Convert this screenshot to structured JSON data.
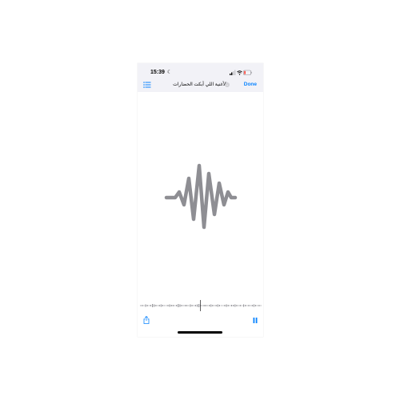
{
  "status_bar": {
    "time": "15:39",
    "moon_glyph": "☾"
  },
  "nav": {
    "title": "الأغنية اللي أبكت الحضارات",
    "done_label": "Done",
    "chevron_glyph": "⌄",
    "accent_color": "#0a84ff"
  },
  "main": {
    "icon": "audio-waveform-icon",
    "icon_color": "#8e8e93"
  },
  "toolbar": {
    "share_icon": "share-icon",
    "pause_icon": "pause-icon"
  }
}
